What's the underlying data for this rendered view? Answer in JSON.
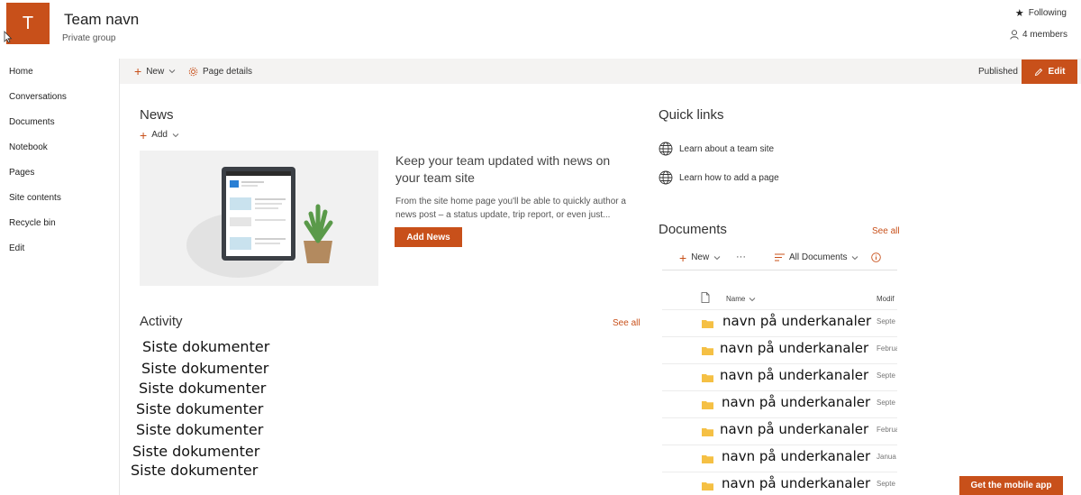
{
  "header": {
    "logo_letter": "T",
    "title": "Team navn",
    "subtitle": "Private group",
    "following_label": "Following",
    "members_label": "4 members"
  },
  "nav": {
    "items": [
      {
        "label": "Home"
      },
      {
        "label": "Conversations"
      },
      {
        "label": "Documents"
      },
      {
        "label": "Notebook"
      },
      {
        "label": "Pages"
      },
      {
        "label": "Site contents"
      },
      {
        "label": "Recycle bin"
      },
      {
        "label": "Edit"
      }
    ]
  },
  "command_bar": {
    "new_label": "New",
    "page_details_label": "Page details",
    "status": "Published",
    "edit_label": "Edit"
  },
  "news": {
    "title": "News",
    "add_label": "Add",
    "heading": "Keep your team updated with news on your team site",
    "description": "From the site home page you'll be able to quickly author a news post – a status update, trip report, or even just...",
    "add_news_label": "Add News"
  },
  "activity": {
    "title": "Activity",
    "see_all": "See all",
    "items": [
      "Siste dokumenter",
      "Siste dokumenter",
      "Siste dokumenter",
      "Siste dokumenter",
      "Siste dokumenter",
      "Siste dokumenter",
      "Siste dokumenter"
    ]
  },
  "quick_links": {
    "title": "Quick links",
    "items": [
      {
        "label": "Learn about a team site",
        "icon": "globe-icon"
      },
      {
        "label": "Learn how to add a page",
        "icon": "globe-icon"
      }
    ]
  },
  "documents": {
    "title": "Documents",
    "see_all": "See all",
    "new_label": "New",
    "more_label": "···",
    "view_label": "All Documents",
    "col_name": "Name",
    "col_modified": "Modif",
    "rows": [
      {
        "name": "navn på underkanaler",
        "modified": "Septe"
      },
      {
        "name": "navn på underkanaler",
        "modified": "Februa"
      },
      {
        "name": "navn på underkanaler",
        "modified": "Septe"
      },
      {
        "name": "navn på underkanaler",
        "modified": "Septe"
      },
      {
        "name": "navn på underkanaler",
        "modified": "Februa"
      },
      {
        "name": "navn på underkanaler",
        "modified": "Janua"
      },
      {
        "name": "navn på underkanaler",
        "modified": "Septe"
      }
    ]
  },
  "mobile_app_label": "Get the mobile app",
  "colors": {
    "accent": "#c8501a",
    "command_bar_bg": "#f4f3f2",
    "folder": "#f5c044"
  }
}
